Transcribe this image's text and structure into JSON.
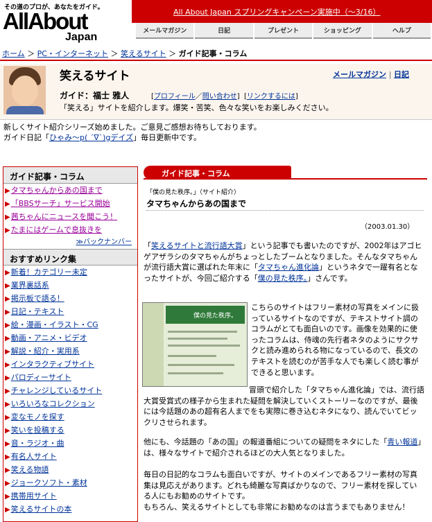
{
  "header": {
    "tagline": "その道のプロが、あなたをガイド。",
    "logo_main": "AllAbout",
    "logo_sub": "Japan",
    "campaign": "All About Japan スプリングキャンペーン実施中（〜3/16）",
    "nav": [
      "メールマガジン",
      "日記",
      "プレゼント",
      "ショッピング",
      "ヘルプ"
    ]
  },
  "breadcrumb": {
    "items": [
      "ホーム",
      "PC・インターネット",
      "笑えるサイト"
    ],
    "separator": "＞",
    "current": "ガイド記事・コラム"
  },
  "guide": {
    "site_title": "笑えるサイト",
    "links": [
      "メールマガジン",
      "日記"
    ],
    "name": "ガイド：福士 雅人",
    "profile_link": "プロフィール",
    "contact_link": "問い合わせ",
    "link_link": "リンクするには",
    "description": "「笑える」サイトを紹介します。爆笑・苦笑、色々な笑いをお楽しみください。"
  },
  "notice": {
    "line1": "新しくサイト紹介シリーズ始めました。ご意見ご感想お待ちしております。",
    "line2_prefix": "ガイド日記「",
    "line2_link": "ひゃみ〜p( ´∇`)gデイズ",
    "line2_suffix": "」毎日更新中です。"
  },
  "sidebar": {
    "section1_title": "ガイド記事・コラム",
    "section1_items": [
      "タマちゃんからあの国まで",
      "「BBSサーチ」サービス開始",
      "茜ちゃんにニュースを聞こう！",
      "たまにはゲームで息抜きを"
    ],
    "backnumber": "≫バックナンバー",
    "section2_title": "おすすめリンク集",
    "section2_items": [
      "新着！カテゴリー未定",
      "業界裏話系",
      "掲示板で語る！",
      "日記・テキスト",
      "絵・漫画・イラスト・CG",
      "動画・アニメ・ビデオ",
      "解説・紹介・実用系",
      "インタラクティブサイト",
      "パロディーサイト",
      "チャレンジしているサイト",
      "いろいろなコレクション",
      "変なモノを探す",
      "笑いを投稿する",
      "音・ラジオ・曲",
      "有名人サイト",
      "笑える物語",
      "ジョークソフト・素材",
      "携帯用サイト",
      "笑えるサイトの本"
    ]
  },
  "main": {
    "tab_label": "ガイド記事・コラム",
    "kicker": "「僕の見た秩序。」（サイト紹介）",
    "title": "タマちゃんからあの国まで",
    "date": "（2003.01.30）",
    "p1": [
      "「",
      "笑えるサイトと流行語大賞",
      "」という記事でも書いたのですが、2002年はアゴヒゲアザラシのタマちゃんがちょっとしたブームとなりました。そんなタマちゃんが流行語大賞に選ばれた年末に「",
      "タマちゃん進化論",
      "」というネタで一躍有名となったサイトが、今回ご紹介する「",
      "僕の見た秩序。",
      "」さんです。"
    ],
    "p2a": "こちらのサイトはフリー素材の写真をメインに扱っているサイトなのですが、テキストサイト調のコラムがとても面白いのです。画像を効果的に使ったコラムは、侍魂の先行者ネタのようにサクサクと読み進められる物になっているので、長文のテキストを読むのが苦手な人でも楽しく読む事ができると思います。",
    "p2b": "冒頭で紹介した「タマちゃん進化論」では、流行語大賞受賞式の様子から生まれた疑問を解決していくストーリーなのですが、最後には今話題のあの超有名人までをも実際に巻き込むネタになり、読んでいてビックリさせられます。",
    "p3": [
      "他にも、今話題の「あの国」の報道番組についての疑問をネタにした「",
      "青い報道",
      "」は、様々なサイトで紹介されるほどの大人気となりました。"
    ],
    "p4": "毎日の日記的なコラムも面白いですが、サイトのメインであるフリー素材の写真集は見応えがあります。どれも綺麗な写真ばかりなので、フリー素材を探している人にもお勧めのサイトです。",
    "p5": "もちろん、笑えるサイトとしても非常にお勧めなのは言うまでもありません！",
    "screenshot_caption": "僕の見た秩序。"
  }
}
